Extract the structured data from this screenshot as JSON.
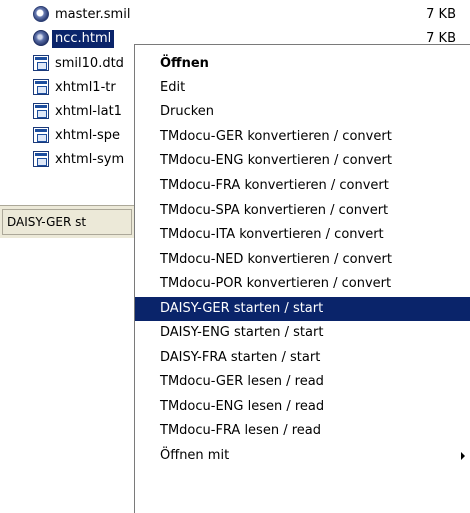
{
  "explorer": {
    "files": [
      {
        "name": "master.smil",
        "size": "7 KB",
        "icon": "smil-file-icon"
      },
      {
        "name": "ncc.html",
        "size": "7 KB",
        "icon": "html-file-icon"
      },
      {
        "name": "smil10.dtd",
        "size": "",
        "icon": "document-file-icon"
      },
      {
        "name": "xhtml1-tr",
        "size": "",
        "icon": "document-file-icon"
      },
      {
        "name": "xhtml-lat1",
        "size": "",
        "icon": "document-file-icon"
      },
      {
        "name": "xhtml-spe",
        "size": "",
        "icon": "document-file-icon"
      },
      {
        "name": "xhtml-sym",
        "size": "",
        "icon": "document-file-icon"
      }
    ],
    "status_text": "DAISY-GER st"
  },
  "context_menu": {
    "items": [
      {
        "label": "Öffnen"
      },
      {
        "label": "Edit"
      },
      {
        "label": "Drucken"
      },
      {
        "label": "TMdocu-GER konvertieren / convert"
      },
      {
        "label": "TMdocu-ENG konvertieren / convert"
      },
      {
        "label": "TMdocu-FRA konvertieren / convert"
      },
      {
        "label": "TMdocu-SPA konvertieren / convert"
      },
      {
        "label": "TMdocu-ITA konvertieren / convert"
      },
      {
        "label": "TMdocu-NED konvertieren / convert"
      },
      {
        "label": "TMdocu-POR konvertieren / convert"
      },
      {
        "label": "DAISY-GER starten / start"
      },
      {
        "label": "DAISY-ENG starten / start"
      },
      {
        "label": "DAISY-FRA starten / start"
      },
      {
        "label": "TMdocu-GER lesen / read"
      },
      {
        "label": "TMdocu-ENG lesen / read"
      },
      {
        "label": "TMdocu-FRA lesen / read"
      },
      {
        "label": "Öffnen mit"
      }
    ]
  },
  "colors": {
    "selection": "#0a246a",
    "selection_text": "#ffffff",
    "statusbar": "#ece9d8"
  }
}
